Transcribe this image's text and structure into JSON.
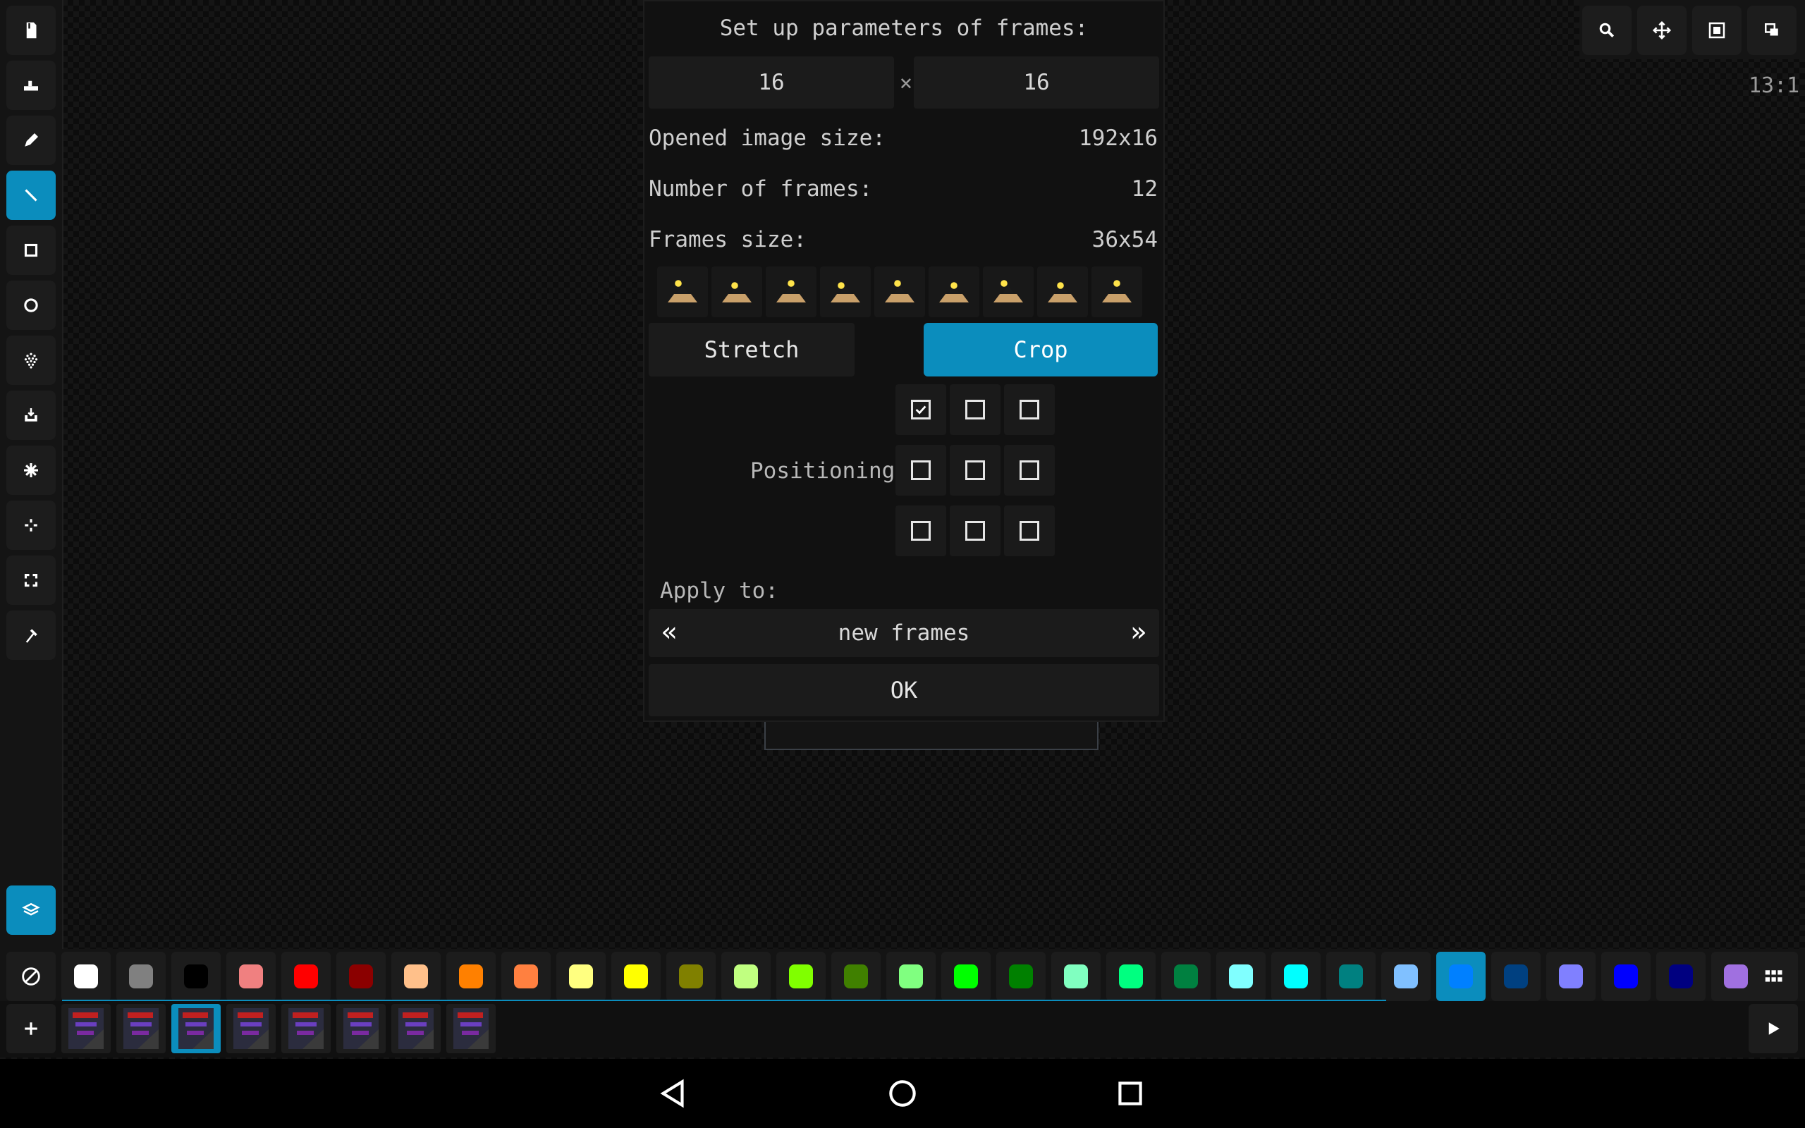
{
  "dialog": {
    "title": "Set up parameters of frames:",
    "width_value": "16",
    "times": "×",
    "height_value": "16",
    "opened_size_label": "Opened image size:",
    "opened_size_value": "192x16",
    "num_frames_label": "Number of frames:",
    "num_frames_value": "12",
    "frames_size_label": "Frames size:",
    "frames_size_value": "36x54",
    "stretch_label": "Stretch",
    "crop_label": "Crop",
    "positioning_label": "Positioning",
    "positioning_checked": [
      true,
      false,
      false,
      false,
      false,
      false,
      false,
      false,
      false
    ],
    "apply_label": "Apply to:",
    "apply_value": "new frames",
    "prev_glyph": "«",
    "next_glyph": "»",
    "ok_label": "OK"
  },
  "zoom": "13:1",
  "tools": [
    {
      "icon": "new-file-icon"
    },
    {
      "icon": "eraser-icon"
    },
    {
      "icon": "pencil-icon"
    },
    {
      "icon": "line-icon",
      "active": true
    },
    {
      "icon": "rectangle-icon"
    },
    {
      "icon": "circle-icon"
    },
    {
      "icon": "spray-icon"
    },
    {
      "icon": "fill-icon"
    },
    {
      "icon": "effect-icon"
    },
    {
      "icon": "move-icon"
    },
    {
      "icon": "select-icon"
    },
    {
      "icon": "color-picker-icon"
    }
  ],
  "layers_icon": "layers-icon",
  "right_tools": [
    "search-icon",
    "pan-icon",
    "fit-screen-icon",
    "duplicate-icon"
  ],
  "palette": {
    "colors": [
      "#ffffff",
      "#808080",
      "#000000",
      "#f08080",
      "#ff0000",
      "#8b0000",
      "#ffc08a",
      "#ff8000",
      "#ff8040",
      "#ffff80",
      "#ffff00",
      "#808000",
      "#c0ff80",
      "#80ff00",
      "#408000",
      "#80ff80",
      "#00ff00",
      "#008000",
      "#80ffc0",
      "#00ff80",
      "#008040",
      "#80ffff",
      "#00ffff",
      "#008080",
      "#80c0ff",
      "#0080ff",
      "#004080",
      "#8080ff",
      "#0000ff",
      "#000080",
      "#a070e0"
    ],
    "selected_index": 25
  },
  "frames": {
    "count": 8,
    "selected_index": 2
  },
  "icons": {
    "no_color": "no-color-icon",
    "grid": "grid-icon",
    "add": "add-frame-icon",
    "play": "play-icon",
    "back": "back-icon",
    "home": "home-icon",
    "recents": "recents-icon"
  }
}
